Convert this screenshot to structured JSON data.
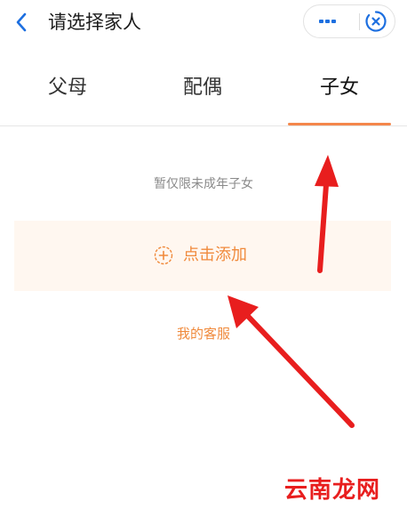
{
  "header": {
    "title": "请选择家人",
    "back_icon": "chevron-left-icon",
    "more_icon": "more-dots-icon",
    "close_icon": "close-circle-icon",
    "accent_color": "#1d6fe0"
  },
  "tabs": [
    {
      "label": "父母",
      "active": false
    },
    {
      "label": "配偶",
      "active": false
    },
    {
      "label": "子女",
      "active": true
    }
  ],
  "content": {
    "hint": "暂仅限未成年子女",
    "add_label": "点击添加",
    "add_icon": "plus-circle-icon",
    "service_link": "我的客服"
  },
  "colors": {
    "accent_orange": "#f08a3c",
    "tab_indicator": "#f4874b",
    "add_box_bg": "#fff7f0",
    "annotation_red": "#e81e1e"
  },
  "watermark": "云南龙网"
}
